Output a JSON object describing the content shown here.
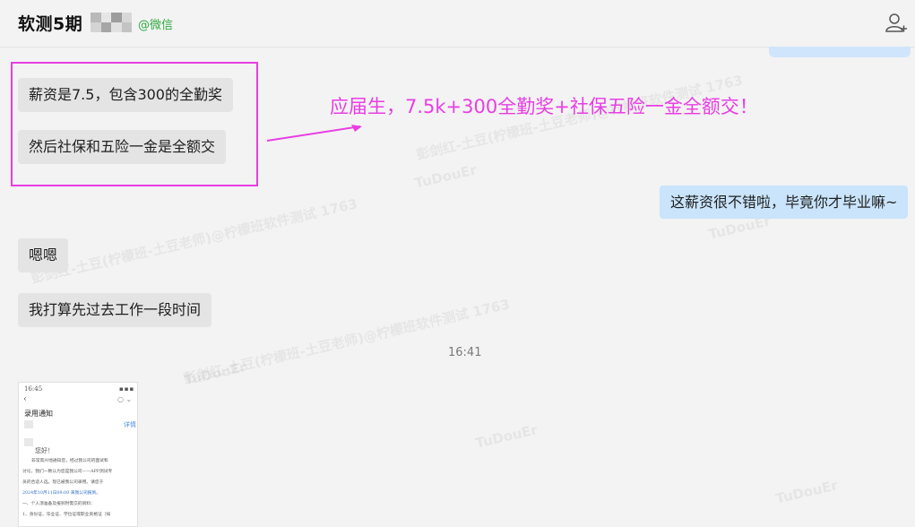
{
  "header": {
    "title": "软测5期",
    "tag": "@微信"
  },
  "messages": {
    "m1": "薪资是7.5，包含300的全勤奖",
    "m2": "然后社保和五险一金是全额交",
    "m3": "这薪资很不错啦，毕竟你才毕业嘛~",
    "m4": "嗯嗯",
    "m5": "我打算先过去工作一段时间"
  },
  "annotation": "应届生，7.5k+300全勤奖+社保五险一金全额交！",
  "timestamp": "16:41",
  "attachment": {
    "status_time": "16:45",
    "heading": "录用通知",
    "link": "详情",
    "greeting": "您好！",
    "line1": "非常高兴地通知您，经过我公司的面试和",
    "line2": "讨论，我们一致认为您是我公司——APP测试专",
    "line3": "员的合适人选。现已被我公司录用。请您于",
    "line4": "2024年10月11日09:00 来我公司报到。",
    "line5": "一、个人须准备及报到时需交的资料：",
    "line6": "1、身份证、毕业证、学位证或职业资格证（如"
  },
  "watermark": {
    "line1": "彭剑红-土豆(柠檬班-土豆老师)@柠檬班软件测试 1763",
    "line2": "TuDouEr"
  },
  "colors": {
    "accent": "#e83ee3",
    "wechat_green": "#2faa3f",
    "bubble_right": "#c9e4fb",
    "bubble_left": "#e4e4e4"
  }
}
